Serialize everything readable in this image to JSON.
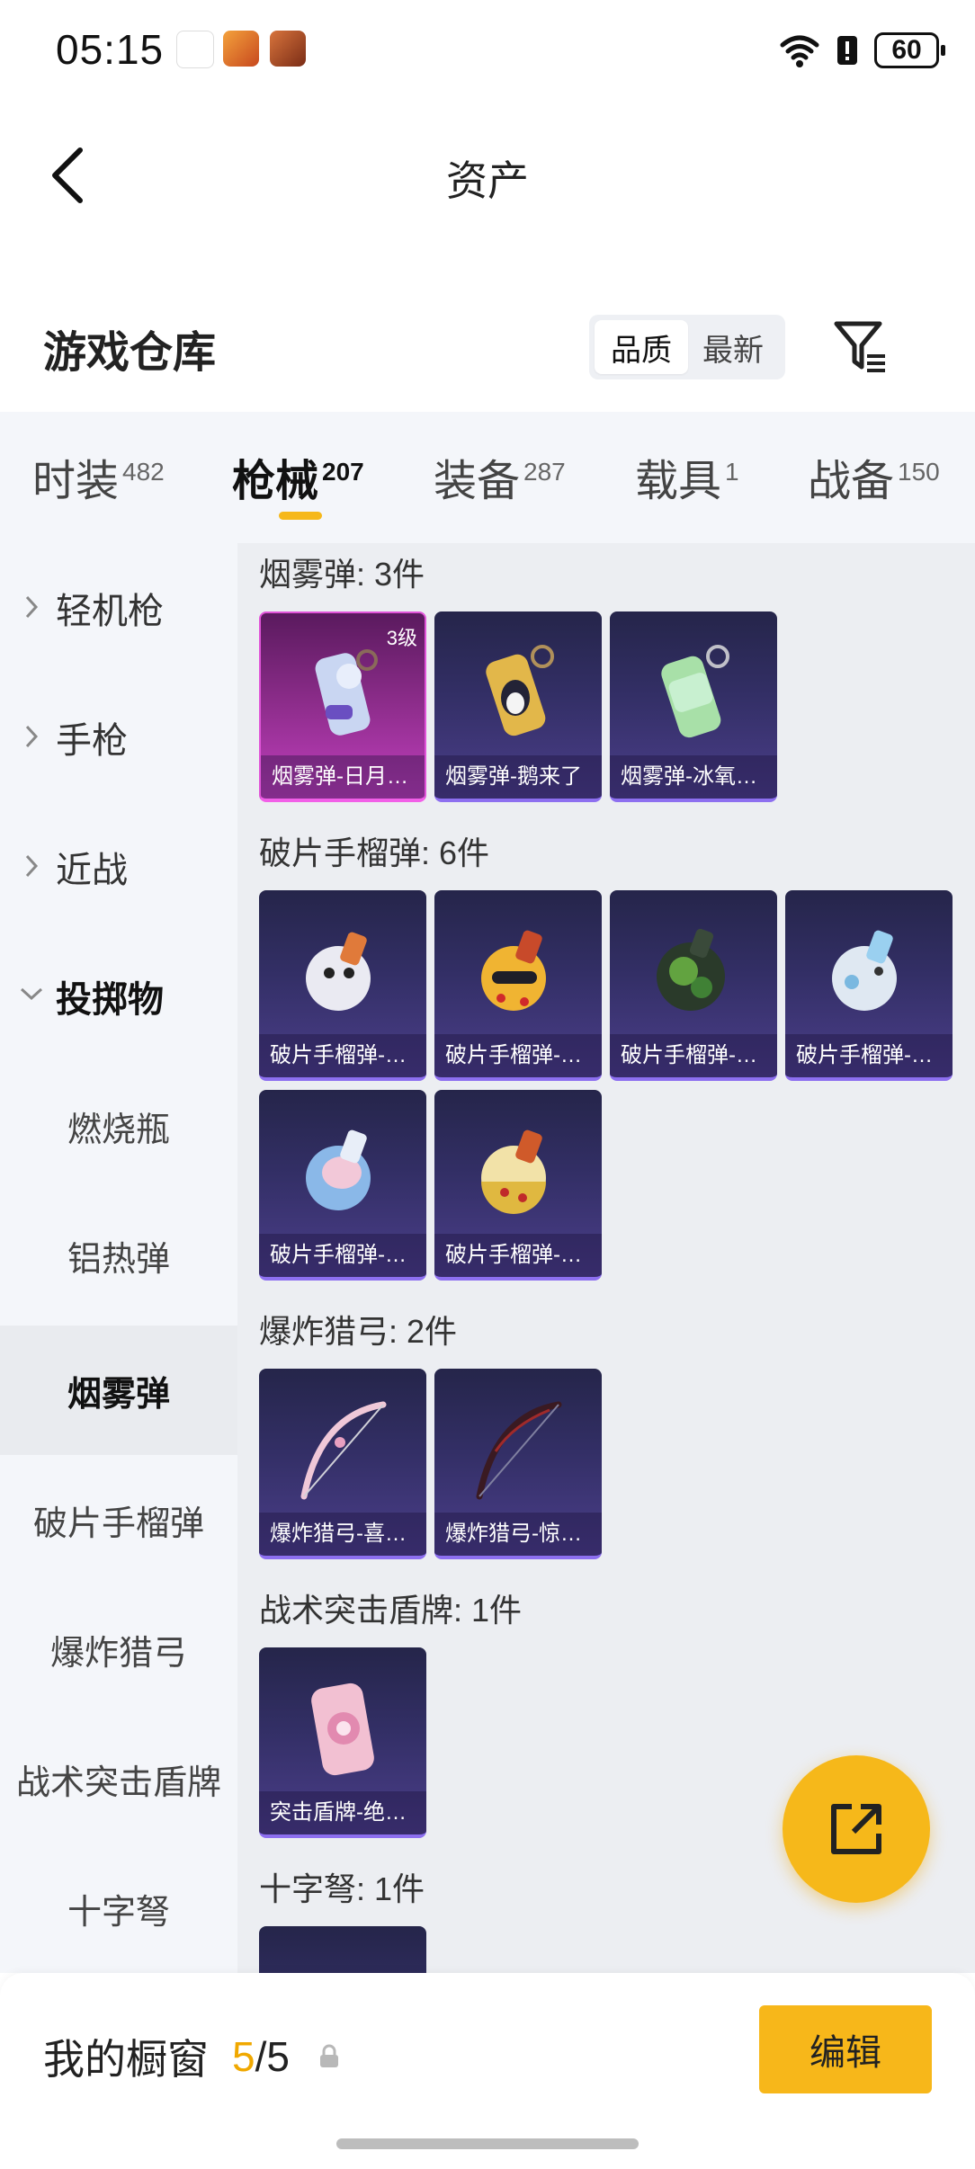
{
  "status": {
    "time": "05:15",
    "battery": "60"
  },
  "nav": {
    "title": "资产"
  },
  "warehouse": {
    "title": "游戏仓库",
    "sort_quality": "品质",
    "sort_latest": "最新"
  },
  "tabs": [
    {
      "label": "时装",
      "count": "482"
    },
    {
      "label": "枪械",
      "count": "207"
    },
    {
      "label": "装备",
      "count": "287"
    },
    {
      "label": "载具",
      "count": "1"
    },
    {
      "label": "战备",
      "count": "150"
    }
  ],
  "sidebar": {
    "items": [
      {
        "label": "轻机枪"
      },
      {
        "label": "手枪"
      },
      {
        "label": "近战"
      },
      {
        "label": "投掷物"
      },
      {
        "label": "燃烧瓶"
      },
      {
        "label": "铝热弹"
      },
      {
        "label": "烟雾弹"
      },
      {
        "label": "破片手榴弹"
      },
      {
        "label": "爆炸猎弓"
      },
      {
        "label": "战术突击盾牌"
      },
      {
        "label": "十字弩"
      }
    ]
  },
  "sections": [
    {
      "title": "烟雾弹: 3件",
      "cards": [
        {
          "label": "烟雾弹-日月…",
          "level": "3级"
        },
        {
          "label": "烟雾弹-鹅来了"
        },
        {
          "label": "烟雾弹-冰氧…"
        }
      ]
    },
    {
      "title": "破片手榴弹: 6件",
      "cards": [
        {
          "label": "破片手榴弹-…"
        },
        {
          "label": "破片手榴弹-…"
        },
        {
          "label": "破片手榴弹-…"
        },
        {
          "label": "破片手榴弹-…"
        },
        {
          "label": "破片手榴弹-…"
        },
        {
          "label": "破片手榴弹-…"
        }
      ]
    },
    {
      "title": "爆炸猎弓: 2件",
      "cards": [
        {
          "label": "爆炸猎弓-喜…"
        },
        {
          "label": "爆炸猎弓-惊…"
        }
      ]
    },
    {
      "title": "战术突击盾牌: 1件",
      "cards": [
        {
          "label": "突击盾牌-绝…"
        }
      ]
    },
    {
      "title": "十字弩: 1件"
    }
  ],
  "bottom": {
    "showcase_label": "我的橱窗",
    "count_current": "5",
    "count_sep": "/",
    "count_total": "5",
    "edit_label": "编辑"
  },
  "colors": {
    "accent": "#f6b81a",
    "card_purple": "#332f66",
    "card_pink": "#c13fbe"
  },
  "icons": [
    "back-arrow-icon",
    "filter-icon",
    "external-link-icon",
    "lock-icon",
    "wifi-icon",
    "battery-icon"
  ]
}
